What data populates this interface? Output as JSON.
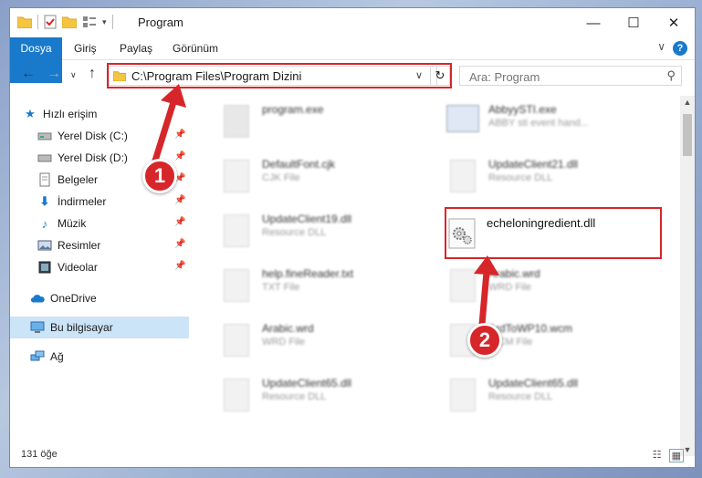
{
  "window": {
    "title": "Program",
    "minimize_glyph": "—",
    "maximize_glyph": "☐",
    "close_glyph": "✕"
  },
  "ribbon": {
    "tabs": [
      "Dosya",
      "Giriş",
      "Paylaş",
      "Görünüm"
    ],
    "collapse_glyph": "∨",
    "help_glyph": "?"
  },
  "address": {
    "path": "C:\\Program Files\\Program Dizini",
    "dropdown_glyph": "∨",
    "refresh_glyph": "↻"
  },
  "search": {
    "placeholder": "Ara: Program"
  },
  "sidebar": {
    "items": [
      {
        "label": "Hızlı erişim",
        "icon": "star-icon",
        "pinned": false
      },
      {
        "label": "Yerel Disk (C:)",
        "icon": "drive-icon",
        "pinned": true
      },
      {
        "label": "Yerel Disk (D:)",
        "icon": "drive-icon",
        "pinned": true
      },
      {
        "label": "Belgeler",
        "icon": "documents-icon",
        "pinned": true
      },
      {
        "label": "İndirmeler",
        "icon": "download-icon",
        "pinned": true
      },
      {
        "label": "Müzik",
        "icon": "music-icon",
        "pinned": true
      },
      {
        "label": "Resimler",
        "icon": "pictures-icon",
        "pinned": true
      },
      {
        "label": "Videolar",
        "icon": "video-icon",
        "pinned": true
      },
      {
        "label": "OneDrive",
        "icon": "cloud-icon",
        "pinned": false
      },
      {
        "label": "Bu bilgisayar",
        "icon": "computer-icon",
        "pinned": false,
        "selected": true
      },
      {
        "label": "Ağ",
        "icon": "network-icon",
        "pinned": false
      }
    ]
  },
  "files": {
    "left": [
      {
        "name": "program.exe",
        "type": ""
      },
      {
        "name": "DefaultFont.cjk",
        "type": "CJK File"
      },
      {
        "name": "UpdateClient19.dll",
        "type": "Resource DLL"
      },
      {
        "name": "help.fineReader.txt",
        "type": "TXT File"
      },
      {
        "name": "Arabic.wrd",
        "type": "WRD File"
      },
      {
        "name": "UpdateClient65.dll",
        "type": "Resource DLL"
      }
    ],
    "right": [
      {
        "name": "AbbyySTI.exe",
        "type": "ABBY sti event hand..."
      },
      {
        "name": "UpdateClient21.dll",
        "type": "Resource DLL"
      },
      {
        "name": "echeloningredient.dll",
        "type": "",
        "highlight": true
      },
      {
        "name": "Arabic.wrd",
        "type": "WRD File"
      },
      {
        "name": "ArdToWP10.wcm",
        "type": "WCM File"
      },
      {
        "name": "UpdateClient65.dll",
        "type": "Resource DLL"
      }
    ]
  },
  "status": {
    "item_count": "131 öğe"
  },
  "callouts": [
    "1",
    "2"
  ],
  "colors": {
    "accent": "#1979ca",
    "highlight_red": "#d7262a",
    "selected_bg": "#cce4f7"
  }
}
